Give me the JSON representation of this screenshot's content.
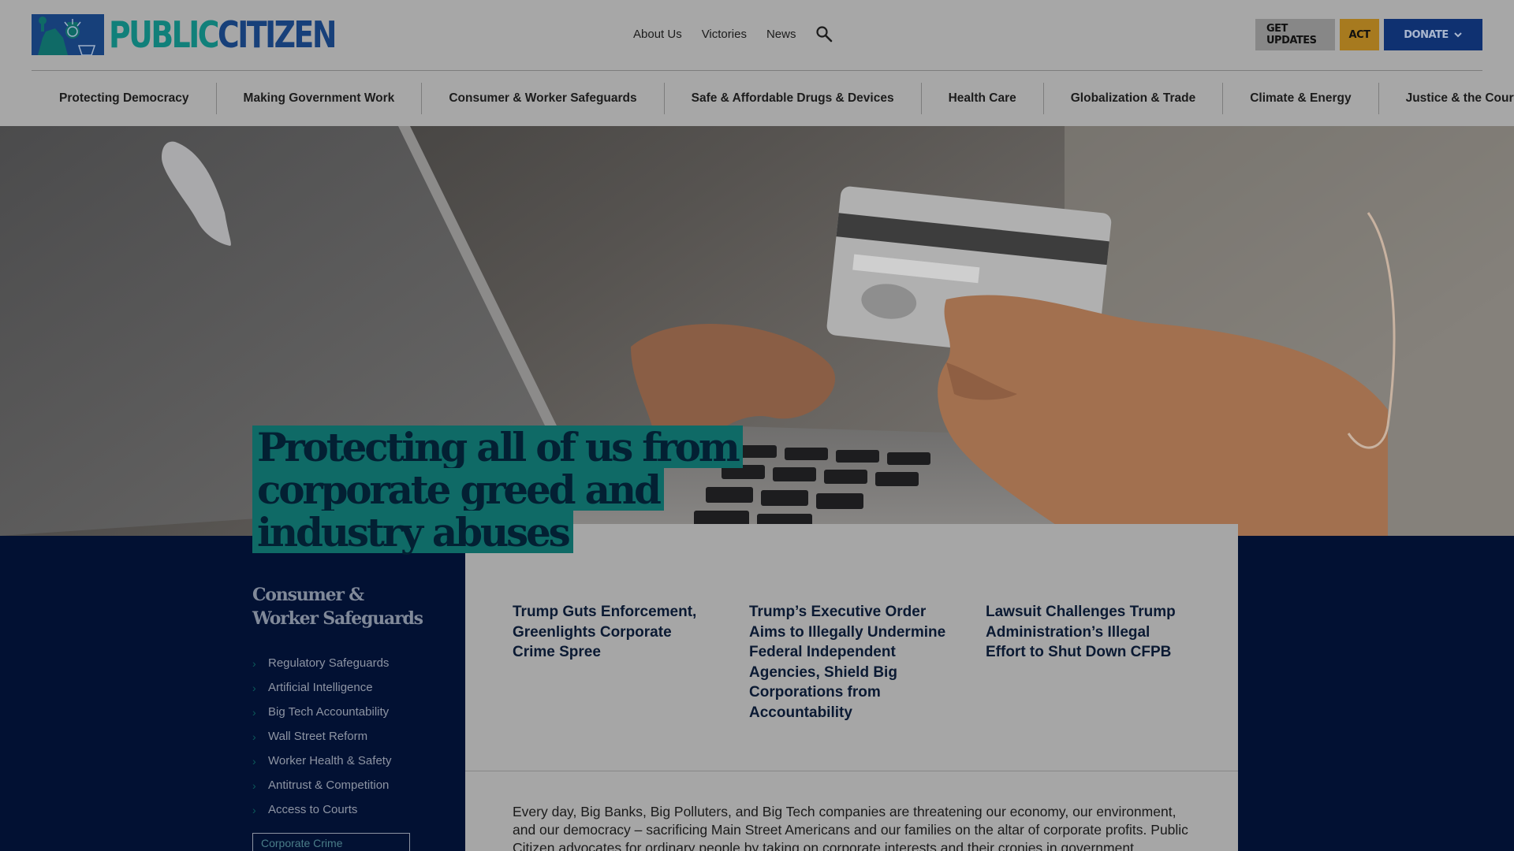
{
  "brand": {
    "public": "PUBLIC",
    "citizen": "CITIZEN",
    "logo_icon": "statue-of-liberty-icon"
  },
  "top_nav": {
    "about": "About Us",
    "victories": "Victories",
    "news": "News",
    "search_icon": "search-icon"
  },
  "actions": {
    "updates": "GET UPDATES",
    "act": "ACT",
    "donate": "DONATE"
  },
  "main_nav": [
    "Protecting Democracy",
    "Making Government Work",
    "Consumer & Worker Safeguards",
    "Safe & Affordable Drugs & Devices",
    "Health Care",
    "Globalization & Trade",
    "Climate & Energy",
    "Justice & the Courts"
  ],
  "hero": {
    "headline_lines": [
      "Protecting all of us from",
      "corporate greed and",
      "industry abuses"
    ]
  },
  "sidebar": {
    "title": "Consumer & Worker Safeguards",
    "items": [
      "Regulatory Safeguards",
      "Artificial Intelligence",
      "Big Tech Accountability",
      "Wall Street Reform",
      "Worker Health & Safety",
      "Antitrust & Competition",
      "Access to Courts"
    ],
    "tag": "Corporate Crime"
  },
  "articles": [
    "Trump Guts Enforcement, Greenlights Corporate Crime Spree",
    "Trump’s Executive Order Aims to Illegally Undermine Federal Independent Agencies, Shield Big Corporations from Accountability",
    "Lawsuit Challenges Trump Administration’s Illegal Effort to Shut Down CFPB"
  ],
  "intro": "Every day, Big Banks, Big Polluters, and Big Tech companies are threatening our economy, our environment, and our democracy – sacrificing Main Street Americans and our families on the altar of corporate profits. Public Citizen advocates for ordinary people by taking on corporate interests and their cronies in government.",
  "colors": {
    "teal": "#11807a",
    "navy": "#021133",
    "gold": "#a77a1f",
    "donate_blue": "#0f3171"
  }
}
